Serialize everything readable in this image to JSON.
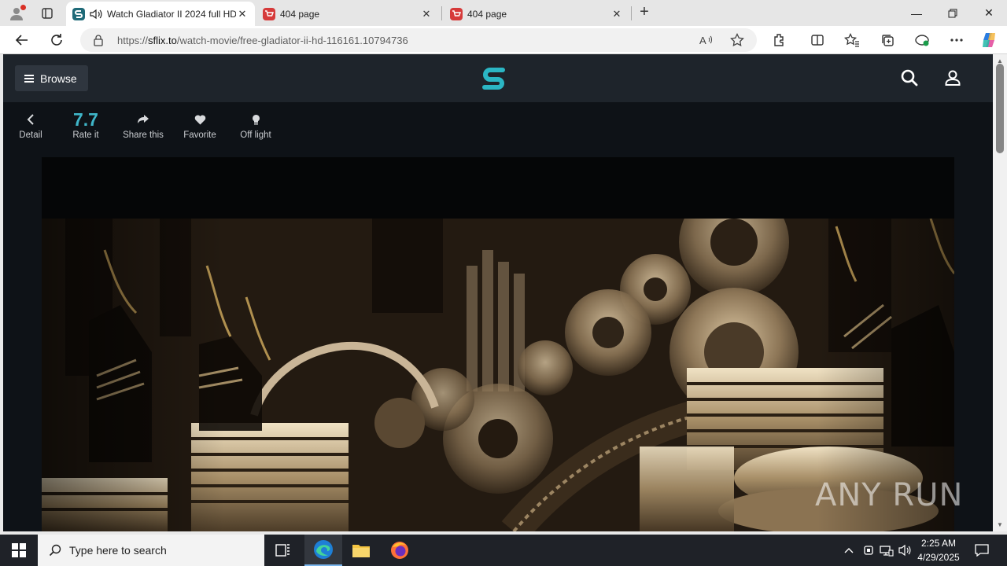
{
  "browser": {
    "tabs": [
      {
        "title": "Watch Gladiator II 2024 full HD",
        "active": true
      },
      {
        "title": "404 page",
        "active": false
      },
      {
        "title": "404 page",
        "active": false
      }
    ],
    "url_prefix": "https://",
    "url_domain": "sflix.to",
    "url_path": "/watch-movie/free-gladiator-ii-hd-116161.10794736"
  },
  "site": {
    "browse_label": "Browse",
    "actions": [
      {
        "label": "Detail",
        "icon": "chevron-left-icon"
      },
      {
        "label": "Rate it",
        "value": "7.7"
      },
      {
        "label": "Share this",
        "icon": "share-icon"
      },
      {
        "label": "Favorite",
        "icon": "heart-icon"
      },
      {
        "label": "Off light",
        "icon": "bulb-icon"
      }
    ],
    "accent_color": "#3fb6c9"
  },
  "watermark": "ANY RUN",
  "taskbar": {
    "search_placeholder": "Type here to search",
    "time": "2:25 AM",
    "date": "4/29/2025"
  }
}
